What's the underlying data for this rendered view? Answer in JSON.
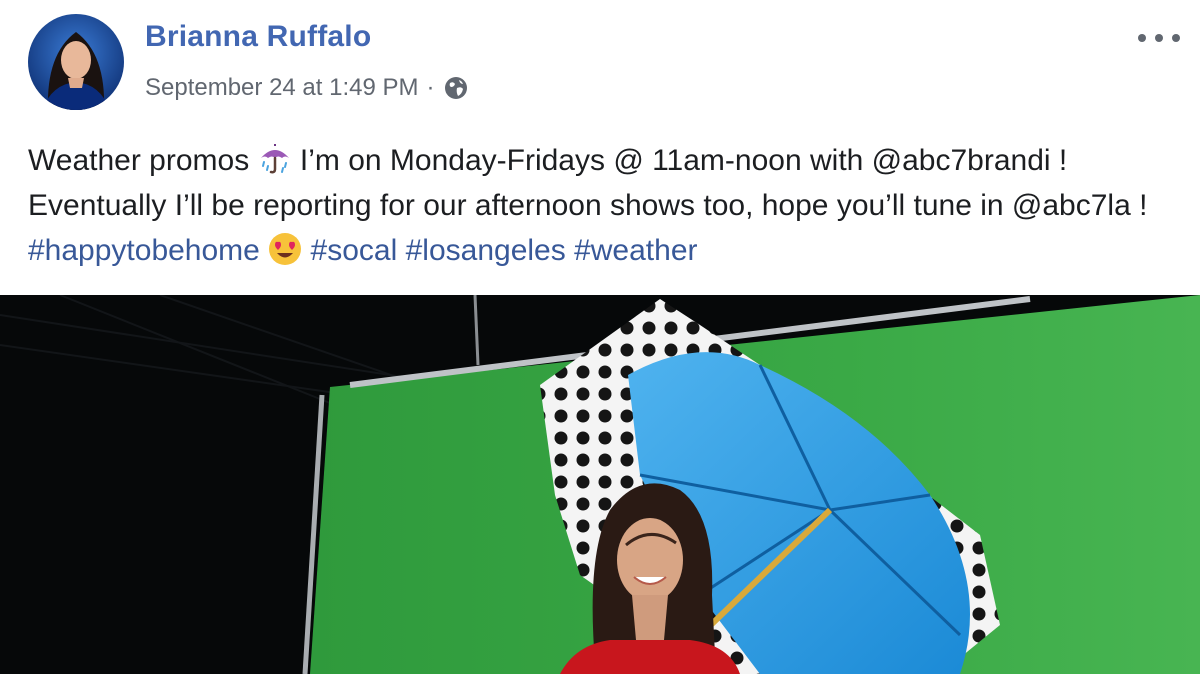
{
  "post": {
    "author": "Brianna Ruffalo",
    "timestamp": "September 24 at 1:49 PM",
    "separator": "·",
    "privacy_icon": "globe-icon",
    "more_icon": "more-options-icon",
    "text": {
      "part1": "Weather promos ",
      "emoji1": "umbrella-with-rain-emoji",
      "part2": " I’m on Monday-Fridays @ 11am-noon with @abc7brandi ! Eventually I’ll be reporting for our afternoon shows too, hope you’ll tune in @abc7la ! ",
      "hashtag1": "#happytobehome",
      "emoji2": "heart-eyes-emoji",
      "hashtag2": "#socal",
      "hashtag3": "#losangeles",
      "hashtag4": "#weather"
    }
  },
  "colors": {
    "link": "#4267b2",
    "hashtag": "#385898",
    "meta": "#616770",
    "text": "#1c1e21"
  }
}
